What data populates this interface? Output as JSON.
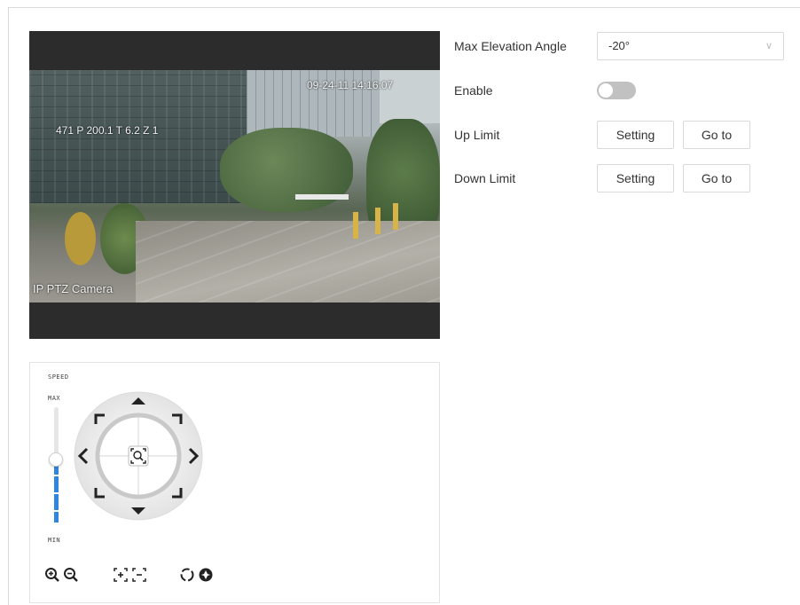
{
  "video": {
    "osd_datetime": "09-24-11 14:16:07",
    "osd_position": "471 P 200.1 T 6.2 Z 1",
    "osd_camera_name": "IP PTZ Camera"
  },
  "ptz": {
    "speed_label": "SPEED",
    "max_label": "MAX",
    "min_label": "MIN",
    "speed_level": 0.55
  },
  "form": {
    "max_elevation_label": "Max Elevation Angle",
    "max_elevation_value": "-20°",
    "enable_label": "Enable",
    "enable_on": false,
    "up_limit_label": "Up Limit",
    "down_limit_label": "Down Limit",
    "setting_label": "Setting",
    "goto_label": "Go to"
  }
}
